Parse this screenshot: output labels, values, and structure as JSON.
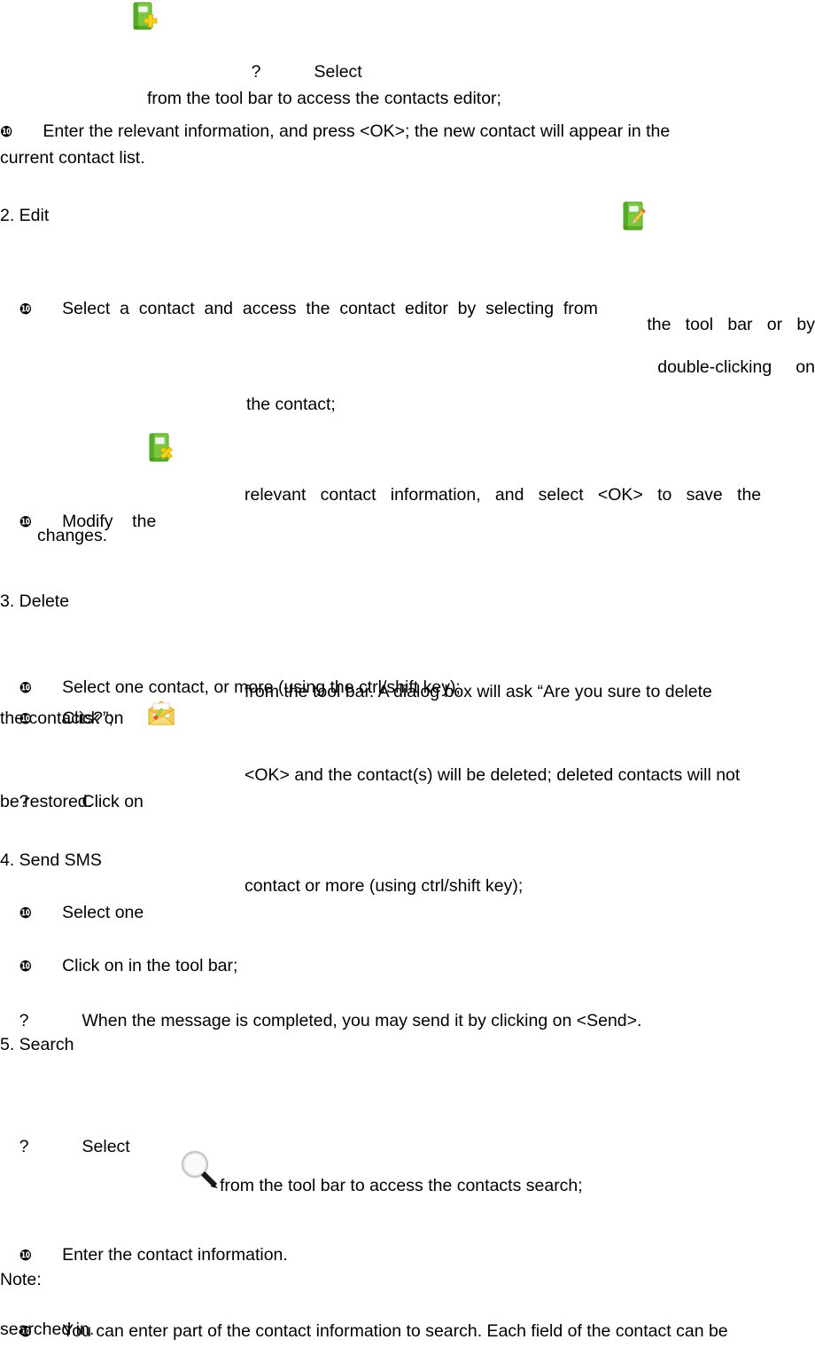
{
  "document": {
    "type": "user-manual-page",
    "topic": "Contacts management",
    "lang": "en"
  },
  "lines": {
    "l1_qmark": "?",
    "l1_select": "Select",
    "l2_from_toolbar": "from the tool bar to access the contacts editor;",
    "l3_bullet": "❿",
    "l3_text": "Enter the relevant information, and press <OK>; the new contact will appear in the",
    "l4_text": "current contact list.",
    "h2_edit": "2. Edit",
    "l5_bullet": "❿",
    "l5_text": "Select  a  contact  and  access  the  contact  editor  by  selecting  from",
    "l6_text": "the   tool   bar   or   by",
    "l7_text": "double-clicking     on",
    "l8_text": "the contact;",
    "l9_bullet": "❿",
    "l9_text_a": "Modify    the",
    "l9_text_b": "relevant   contact   information,   and   select   <OK>   to   save   the",
    "l10_text": "changes.",
    "h3_delete": "3. Delete",
    "l11_bullet": "❿",
    "l11_text": "Select one contact, or more (using the ctrl/shift key);",
    "l12_bullet": "❿",
    "l12_text_a": "Click on",
    "l12_text_b": "from the tool bar. A dialog box will ask “Are you sure to delete",
    "l13_text": "the contacts?”;",
    "l14_qmark": "?",
    "l14_text_a": "Click on",
    "l14_text_b": "<OK> and the contact(s) will be deleted; deleted contacts will not",
    "l15_text": "be restored.",
    "h4_send_sms": "4. Send SMS",
    "l16_bullet": "❿",
    "l16_text_a": "Select one",
    "l16_text_b": "contact or more (using ctrl/shift key);",
    "l17_bullet": "❿",
    "l17_text": "Click on in the tool bar;",
    "l18_qmark": "?",
    "l18_text": "When the message is completed, you may send it by clicking on <Send>.",
    "h5_search": "5. Search",
    "l19_qmark": "?",
    "l19_select": "Select",
    "l20_text": "from the tool bar to access the contacts search;",
    "l21_bullet": "❿",
    "l21_text": "Enter the contact information.",
    "note_label": "Note:",
    "l22_bullet": "❿",
    "l22_text": "You can enter part of the contact information to search. Each field of the contact can be",
    "l23_text": "searched in."
  },
  "icons": {
    "add_contact": {
      "name": "add-contact-icon",
      "description": "green contact book with yellow plus"
    },
    "edit_contact": {
      "name": "edit-contact-icon",
      "description": "green contact book with pencil"
    },
    "delete_contact": {
      "name": "delete-contact-icon",
      "description": "green contact book with yellow x"
    },
    "send_sms": {
      "name": "send-sms-icon",
      "description": "yellow open envelope with letter"
    },
    "search": {
      "name": "search-icon",
      "description": "magnifying glass"
    }
  },
  "colors": {
    "book_green_light": "#8fd44a",
    "book_green_dark": "#3f9e1e",
    "book_green_mid": "#62bd2e",
    "plus_yellow": "#f5d21a",
    "envelope_yellow": "#f2c83c",
    "envelope_deep": "#e0a821",
    "letter_white": "#ffffff",
    "pencil_orange": "#e87a22",
    "glass_grey": "#d9d9d9",
    "handle_dark": "#222222",
    "text_black": "#000000"
  }
}
